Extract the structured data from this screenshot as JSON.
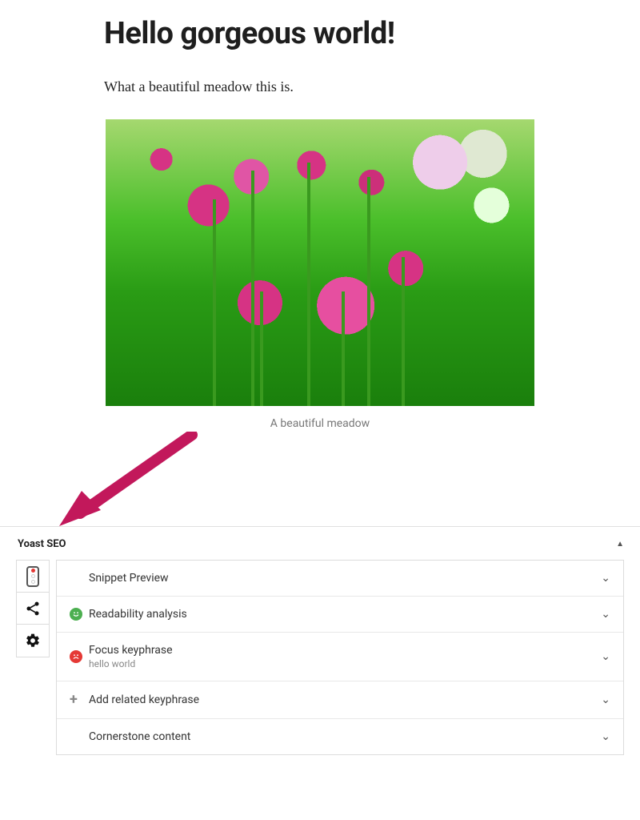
{
  "post": {
    "title": "Hello gorgeous world!",
    "body": "What a beautiful meadow this is.",
    "image_caption": "A beautiful meadow"
  },
  "metabox": {
    "title": "Yoast SEO",
    "caret": "▲"
  },
  "tabs": {
    "content": "content-analysis",
    "social": "social",
    "advanced": "advanced"
  },
  "panels": {
    "snippet": {
      "label": "Snippet Preview"
    },
    "readability": {
      "label": "Readability analysis",
      "status": "ok"
    },
    "focus": {
      "label": "Focus keyphrase",
      "value": "hello world",
      "status": "bad"
    },
    "related": {
      "label": "Add related keyphrase"
    },
    "cornerstone": {
      "label": "Cornerstone content"
    }
  }
}
